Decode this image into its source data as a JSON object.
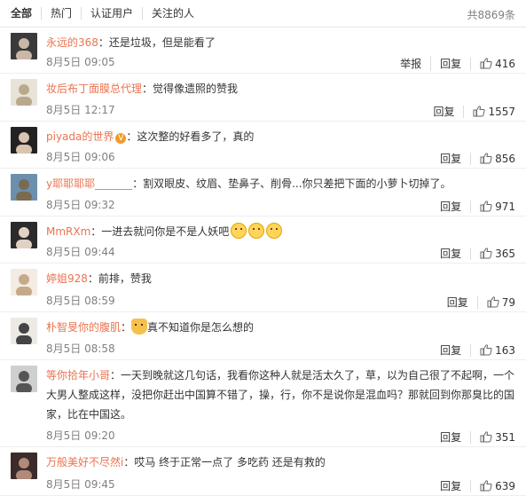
{
  "tabs": [
    "全部",
    "热门",
    "认证用户",
    "关注的人"
  ],
  "total": "共8869条",
  "actions": {
    "report": "举报",
    "reply": "回复"
  },
  "comments": [
    {
      "user": "永远的368",
      "text": "：还是垃圾，但是能看了",
      "date": "8月5日",
      "time": "09:05",
      "likes": "416",
      "report": true,
      "h": 51
    },
    {
      "user": "妆后布丁面膜总代理",
      "text": "：觉得像遗照的赞我",
      "date": "8月5日",
      "time": "12:17",
      "likes": "1557",
      "report": false,
      "h": 53
    },
    {
      "user": "piyada的世界",
      "text": "：这次整的好看多了，真的",
      "date": "8月5日",
      "time": "09:06",
      "likes": "856",
      "report": false,
      "h": 52,
      "vip": true
    },
    {
      "user": "y耶耶耶耶_______",
      "text": "：割双眼皮、纹眉、垫鼻子、削骨...你只差把下面的小萝卜切掉了。",
      "date": "8月5日",
      "time": "09:32",
      "likes": "971",
      "report": false,
      "h": 53
    },
    {
      "user": "MmRXm",
      "text": "：一进去就问你是不是人妖吧",
      "date": "8月5日",
      "time": "09:44",
      "likes": "365",
      "report": false,
      "h": 52,
      "emo": 3
    },
    {
      "user": "婷姐928",
      "text": "：前排，赞我",
      "date": "8月5日",
      "time": "08:59",
      "likes": "79",
      "report": false,
      "h": 54
    },
    {
      "user": "朴智旻你的腹肌",
      "text": "真不知道你是怎么想的",
      "date": "8月5日",
      "time": "08:58",
      "likes": "163",
      "report": false,
      "h": 53,
      "dog": true
    },
    {
      "user": "等你拾年小哥",
      "text": "：一天到晚就这几句话，我看你这种人就是活太久了，草，以为自己很了不起啊，一个大男人整成这样，没把你赶出中国算不错了，操，行，你不是说你是混血吗？那就回到你那臭比的国家，比在中国这。",
      "date": "8月5日",
      "time": "09:20",
      "likes": "351",
      "report": false,
      "h": 97
    },
    {
      "user": "万般美好不尽然i",
      "text": "：哎马 终于正常一点了 多吃药 还是有救的",
      "date": "8月5日",
      "time": "09:45",
      "likes": "639",
      "report": false,
      "h": 54
    }
  ]
}
